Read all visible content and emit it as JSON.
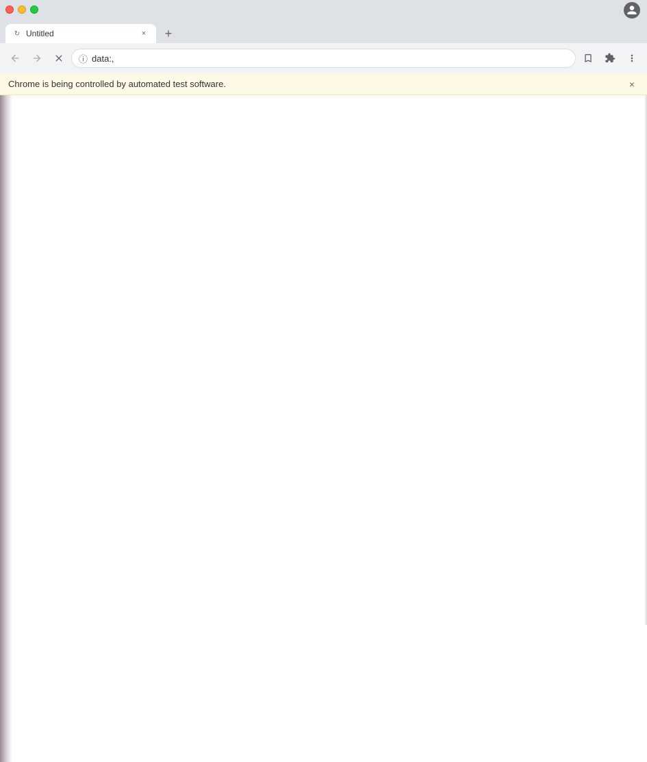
{
  "browser": {
    "title": "Untitled",
    "address_bar": {
      "url": "data:,",
      "info_icon": "ⓘ"
    },
    "tabs": [
      {
        "title": "Untitled",
        "favicon": "↻",
        "active": true
      }
    ],
    "automation_banner": {
      "text": "Chrome is being controlled by automated test software.",
      "close_label": "×"
    },
    "nav": {
      "back_label": "←",
      "forward_label": "→",
      "reload_label": "✕"
    },
    "toolbar": {
      "bookmark_label": "☆",
      "extensions_label": "⬜",
      "menu_label": "⋮"
    }
  }
}
